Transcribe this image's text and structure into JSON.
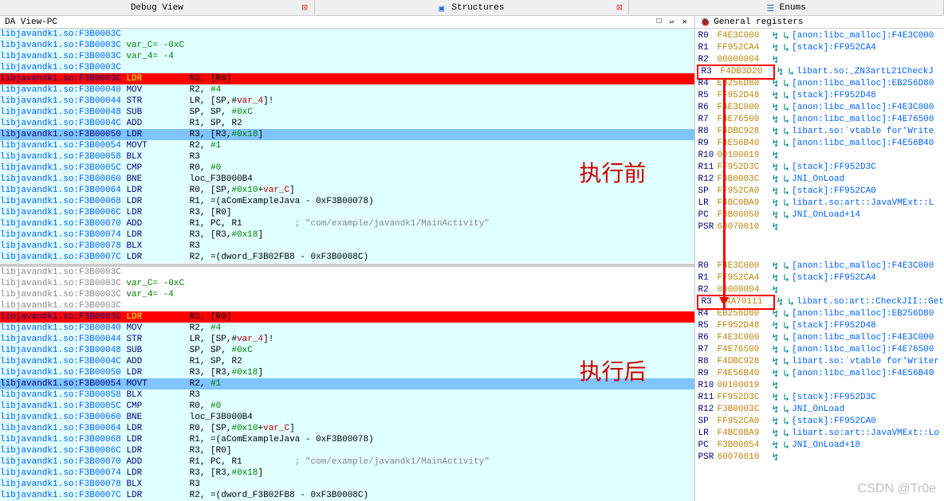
{
  "tabs": {
    "debug": "Debug View",
    "structures": "Structures",
    "enums": "Enums"
  },
  "leftPanelTitle": "DA View-PC",
  "rightPanelTitle": "General registers",
  "annotations": {
    "before": "执行前",
    "after": "执行后"
  },
  "watermark": "CSDN @Tr0e",
  "code1": [
    {
      "bg": "cyan",
      "a": "libjavandk1.so:F3B0003C",
      "t": ""
    },
    {
      "bg": "cyan",
      "a": "libjavandk1.so:F3B0003C",
      "t": " var_C= -0xC",
      "cls": "vardef"
    },
    {
      "bg": "cyan",
      "a": "libjavandk1.so:F3B0003C",
      "t": " var_4= -4",
      "cls": "vardef"
    },
    {
      "bg": "cyan",
      "a": "libjavandk1.so:F3B0003C",
      "t": ""
    },
    {
      "bg": "red",
      "a": "libjavandk1.so:F3B0003C",
      "m": "LDR",
      "o": "R3, [R0]"
    },
    {
      "bg": "cyan",
      "a": "libjavandk1.so:F3B00040",
      "m": "MOV",
      "o": "R2, #4",
      "imm": "#4"
    },
    {
      "bg": "cyan",
      "a": "libjavandk1.so:F3B00044",
      "m": "STR",
      "o": "LR, [SP,#var_4]!",
      "var": "var_4"
    },
    {
      "bg": "cyan",
      "a": "libjavandk1.so:F3B00048",
      "m": "SUB",
      "o": "SP, SP, #0xC",
      "imm": "#0xC"
    },
    {
      "bg": "cyan",
      "a": "libjavandk1.so:F3B0004C",
      "m": "ADD",
      "o": "R1, SP, R2"
    },
    {
      "bg": "blue",
      "a": "libjavandk1.so:F3B00050",
      "m": "LDR",
      "o": "R3, [R3,#0x18]",
      "imm": "#0x18"
    },
    {
      "bg": "cyan",
      "a": "libjavandk1.so:F3B00054",
      "m": "MOVT",
      "o": "R2, #1",
      "imm": "#1"
    },
    {
      "bg": "cyan",
      "a": "libjavandk1.so:F3B00058",
      "m": "BLX",
      "o": "R3"
    },
    {
      "bg": "cyan",
      "a": "libjavandk1.so:F3B0005C",
      "m": "CMP",
      "o": "R0, #0",
      "imm": "#0"
    },
    {
      "bg": "cyan",
      "a": "libjavandk1.so:F3B00060",
      "m": "BNE",
      "o": "loc_F3B000B4"
    },
    {
      "bg": "cyan",
      "a": "libjavandk1.so:F3B00064",
      "m": "LDR",
      "o": "R0, [SP,#0x10+var_C]",
      "imm": "#0x10",
      "var": "var_C"
    },
    {
      "bg": "cyan",
      "a": "libjavandk1.so:F3B00068",
      "m": "LDR",
      "o": "R1, =(aComExampleJava - 0xF3B00078)"
    },
    {
      "bg": "cyan",
      "a": "libjavandk1.so:F3B0006C",
      "m": "LDR",
      "o": "R3, [R0]"
    },
    {
      "bg": "cyan",
      "a": "libjavandk1.so:F3B00070",
      "m": "ADD",
      "o": "R1, PC, R1",
      "c": "; \"com/example/javandk1/MainActivity\""
    },
    {
      "bg": "cyan",
      "a": "libjavandk1.so:F3B00074",
      "m": "LDR",
      "o": "R3, [R3,#0x18]",
      "imm": "#0x18"
    },
    {
      "bg": "cyan",
      "a": "libjavandk1.so:F3B00078",
      "m": "BLX",
      "o": "R3"
    },
    {
      "bg": "cyan",
      "a": "libjavandk1.so:F3B0007C",
      "m": "LDR",
      "o": "R2, =(dword_F3B02FB8 - 0xF3B0008C)"
    }
  ],
  "code2": [
    {
      "bg": "white",
      "a": "libjavandk1.so:F3B0003C",
      "t": ""
    },
    {
      "bg": "white",
      "a": "libjavandk1.so:F3B0003C",
      "t": " var_C= -0xC",
      "cls": "vardef"
    },
    {
      "bg": "white",
      "a": "libjavandk1.so:F3B0003C",
      "t": " var_4= -4",
      "cls": "vardef"
    },
    {
      "bg": "white",
      "a": "libjavandk1.so:F3B0003C",
      "t": ""
    },
    {
      "bg": "red",
      "a": "libjavandk1.so:F3B0003C",
      "m": "LDR",
      "o": "R3, [R0]"
    },
    {
      "bg": "cyan",
      "a": "libjavandk1.so:F3B00040",
      "m": "MOV",
      "o": "R2, #4",
      "imm": "#4"
    },
    {
      "bg": "cyan",
      "a": "libjavandk1.so:F3B00044",
      "m": "STR",
      "o": "LR, [SP,#var_4]!",
      "var": "var_4"
    },
    {
      "bg": "cyan",
      "a": "libjavandk1.so:F3B00048",
      "m": "SUB",
      "o": "SP, SP, #0xC",
      "imm": "#0xC"
    },
    {
      "bg": "cyan",
      "a": "libjavandk1.so:F3B0004C",
      "m": "ADD",
      "o": "R1, SP, R2"
    },
    {
      "bg": "cyan",
      "a": "libjavandk1.so:F3B00050",
      "m": "LDR",
      "o": "R3, [R3,#0x18]",
      "imm": "#0x18"
    },
    {
      "bg": "blue",
      "a": "libjavandk1.so:F3B00054",
      "m": "MOVT",
      "o": "R2, #1",
      "imm": "#1"
    },
    {
      "bg": "cyan",
      "a": "libjavandk1.so:F3B00058",
      "m": "BLX",
      "o": "R3"
    },
    {
      "bg": "cyan",
      "a": "libjavandk1.so:F3B0005C",
      "m": "CMP",
      "o": "R0, #0",
      "imm": "#0"
    },
    {
      "bg": "cyan",
      "a": "libjavandk1.so:F3B00060",
      "m": "BNE",
      "o": "loc_F3B000B4"
    },
    {
      "bg": "cyan",
      "a": "libjavandk1.so:F3B00064",
      "m": "LDR",
      "o": "R0, [SP,#0x10+var_C]",
      "imm": "#0x10",
      "var": "var_C"
    },
    {
      "bg": "cyan",
      "a": "libjavandk1.so:F3B00068",
      "m": "LDR",
      "o": "R1, =(aComExampleJava - 0xF3B00078)"
    },
    {
      "bg": "cyan",
      "a": "libjavandk1.so:F3B0006C",
      "m": "LDR",
      "o": "R3, [R0]"
    },
    {
      "bg": "cyan",
      "a": "libjavandk1.so:F3B00070",
      "m": "ADD",
      "o": "R1, PC, R1",
      "c": "; \"com/example/javandk1/MainActivity\""
    },
    {
      "bg": "cyan",
      "a": "libjavandk1.so:F3B00074",
      "m": "LDR",
      "o": "R3, [R3,#0x18]",
      "imm": "#0x18"
    },
    {
      "bg": "cyan",
      "a": "libjavandk1.so:F3B00078",
      "m": "BLX",
      "o": "R3"
    },
    {
      "bg": "cyan",
      "a": "libjavandk1.so:F3B0007C",
      "m": "LDR",
      "o": "R2, =(dword_F3B02FB8 - 0xF3B0008C)"
    }
  ],
  "regs1": [
    {
      "n": "R0",
      "v": "F4E3C000",
      "l": "[anon:libc_malloc]:F4E3C000"
    },
    {
      "n": "R1",
      "v": "FF952CA4",
      "l": "[stack]:FF952CA4"
    },
    {
      "n": "R2",
      "v": "00000004",
      "nl": true
    },
    {
      "n": "R3",
      "v": "F4DB3D20",
      "l": "libart.so:_ZN3artL21CheckJ",
      "boxed": true
    },
    {
      "n": "R4",
      "v": "EB256D80",
      "l": "[anon:libc_malloc]:EB256D80"
    },
    {
      "n": "R5",
      "v": "FF952D48",
      "l": "[stack]:FF952D48"
    },
    {
      "n": "R6",
      "v": "F4E3C000",
      "l": "[anon:libc_malloc]:F4E3C000"
    },
    {
      "n": "R7",
      "v": "F4E76500",
      "l": "[anon:libc_malloc]:F4E76500"
    },
    {
      "n": "R8",
      "v": "F4DBC928",
      "l": "libart.so:`vtable for'Write"
    },
    {
      "n": "R9",
      "v": "F4E56B40",
      "l": "[anon:libc_malloc]:F4E56B40"
    },
    {
      "n": "R10",
      "v": "00100019",
      "nl": true
    },
    {
      "n": "R11",
      "v": "FF952D3C",
      "l": "[stack]:FF952D3C"
    },
    {
      "n": "R12",
      "v": "F3B0003C",
      "l": "JNI_OnLoad"
    },
    {
      "n": "SP",
      "v": "FF952CA0",
      "l": "[stack]:FF952CA0"
    },
    {
      "n": "LR",
      "v": "F4BC0BA9",
      "l": "libart.so:art::JavaVMExt::L"
    },
    {
      "n": "PC",
      "v": "F3B00050",
      "l": "JNI_OnLoad+14"
    },
    {
      "n": "PSR",
      "v": "60070010",
      "nl": true
    }
  ],
  "regs2": [
    {
      "n": "R0",
      "v": "F4E3C000",
      "l": "[anon:libc_malloc]:F4E3C000"
    },
    {
      "n": "R1",
      "v": "FF952CA4",
      "l": "[stack]:FF952CA4"
    },
    {
      "n": "R2",
      "v": "00000004",
      "nl": true
    },
    {
      "n": "R3",
      "v": "F4A70111",
      "l": "libart.so:art::CheckJII::Get",
      "boxed": true
    },
    {
      "n": "R4",
      "v": "EB256D80",
      "l": "[anon:libc_malloc]:EB256D80"
    },
    {
      "n": "R5",
      "v": "FF952D48",
      "l": "[stack]:FF952D48"
    },
    {
      "n": "R6",
      "v": "F4E3C000",
      "l": "[anon:libc_malloc]:F4E3C000"
    },
    {
      "n": "R7",
      "v": "F4E76500",
      "l": "[anon:libc_malloc]:F4E76500"
    },
    {
      "n": "R8",
      "v": "F4DBC928",
      "l": "libart.so:`vtable for'Writer"
    },
    {
      "n": "R9",
      "v": "F4E56B40",
      "l": "[anon:libc_malloc]:F4E56B40"
    },
    {
      "n": "R10",
      "v": "00100019",
      "nl": true
    },
    {
      "n": "R11",
      "v": "FF952D3C",
      "l": "[stack]:FF952D3C"
    },
    {
      "n": "R12",
      "v": "F3B0003C",
      "l": "JNI_OnLoad"
    },
    {
      "n": "SP",
      "v": "FF952CA0",
      "l": "[stack]:FF952CA0"
    },
    {
      "n": "LR",
      "v": "F4BC0BA9",
      "l": "libart.so:art::JavaVMExt::Lo"
    },
    {
      "n": "PC",
      "v": "F3B00054",
      "l": "JNI_OnLoad+18"
    },
    {
      "n": "PSR",
      "v": "60070010",
      "nl": true
    }
  ]
}
